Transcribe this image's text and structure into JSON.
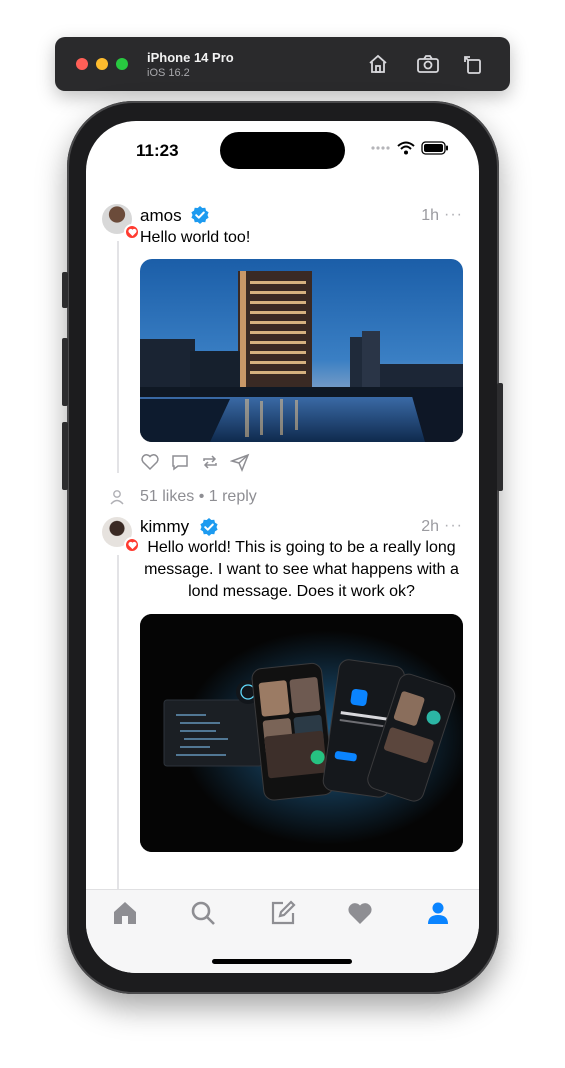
{
  "simulator": {
    "device_name": "iPhone 14 Pro",
    "os_version": "iOS 16.2",
    "buttons": [
      "home-icon",
      "screenshot-icon",
      "rotate-icon"
    ]
  },
  "status_bar": {
    "time": "11:23",
    "icons": [
      "signal-dots-icon",
      "wifi-icon",
      "battery-icon"
    ]
  },
  "posts": [
    {
      "username": "amos",
      "verified": true,
      "time_ago": "1h",
      "more": "···",
      "text": "Hello world too!",
      "media": "hotel-city-river-photo",
      "actions": [
        "like-icon",
        "comment-icon",
        "repost-icon",
        "share-icon"
      ],
      "stats": "51 likes • 1 reply"
    },
    {
      "username": "kimmy",
      "verified": true,
      "time_ago": "2h",
      "more": "···",
      "text": "Hello world! This is going to be a really long message. I want to see what happens with a lond message. Does it work ok?",
      "media": "stream-video-calling-phones-image"
    }
  ],
  "tab_bar": {
    "tabs": [
      "home-tab",
      "search-tab",
      "compose-tab",
      "activity-tab",
      "profile-tab"
    ],
    "active": "profile-tab",
    "active_color": "#0a84ff",
    "inactive_color": "#8e8e93"
  },
  "colors": {
    "verified": "#1d9bf0",
    "badge": "#ff3b30"
  }
}
